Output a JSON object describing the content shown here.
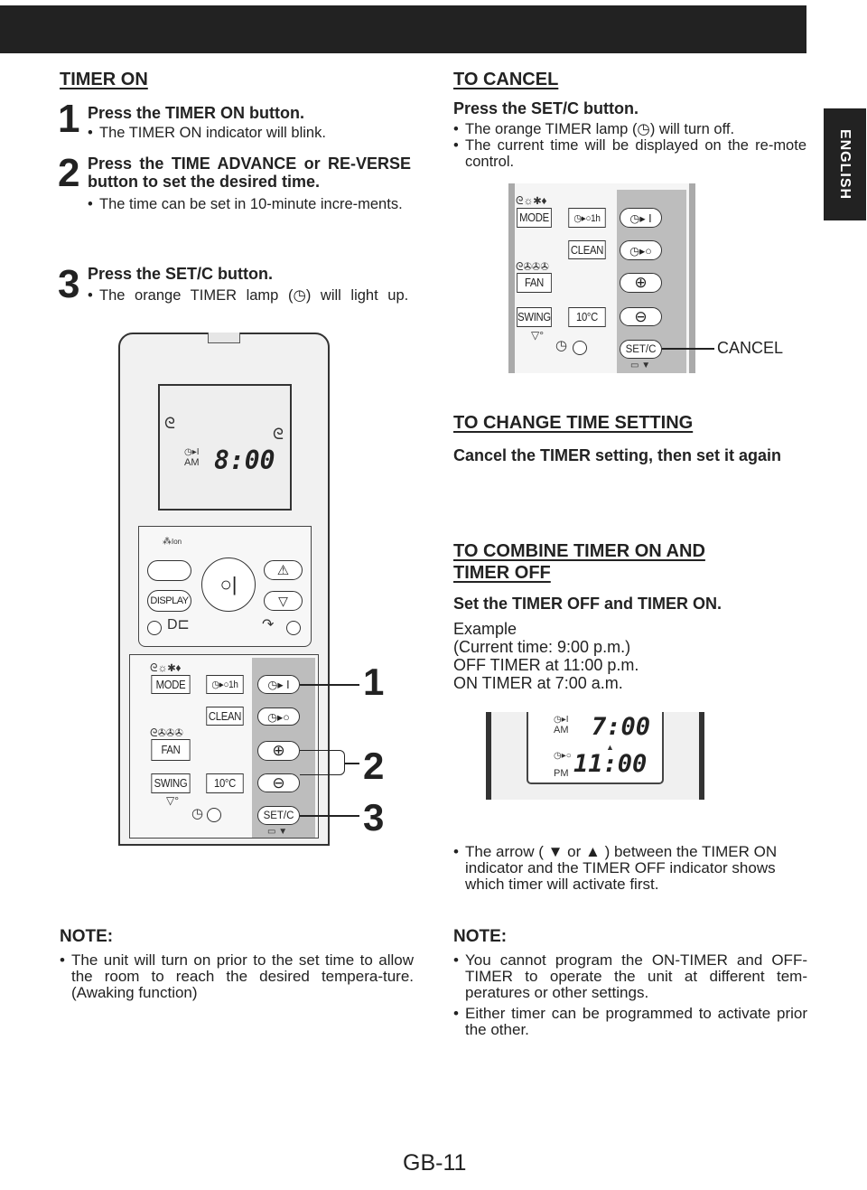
{
  "header": {
    "language_tab": "ENGLISH"
  },
  "timer_on": {
    "heading": "TIMER ON",
    "steps": [
      {
        "number": "1",
        "title": "Press the TIMER ON button.",
        "bullets": [
          "The TIMER ON indicator will blink."
        ]
      },
      {
        "number": "2",
        "title": "Press the TIME ADVANCE or RE-VERSE button to set the desired time.",
        "bullets": [
          "The time can be set in 10-minute incre-ments."
        ]
      },
      {
        "number": "3",
        "title": "Press the SET/C button.",
        "bullets": [
          "The orange TIMER lamp (",
          "◷",
          ") will light up."
        ]
      }
    ]
  },
  "remote": {
    "display": {
      "indicator": "◷▸I",
      "ampm": "AM",
      "time": "8:00"
    },
    "ion_label": "Ion",
    "display_button": "DISPLAY",
    "mode": "MODE",
    "timer_1h": "◷▸○1h",
    "clean": "CLEAN",
    "fan": "FAN",
    "swing": "SWING",
    "temp10": "10°C",
    "setc": "SET/C",
    "timer_on_btn": "◷▸ I",
    "timer_off_btn": "◷▸○",
    "plus": "⊕",
    "minus": "⊖",
    "callouts": [
      "1",
      "2",
      "3"
    ]
  },
  "to_cancel": {
    "heading": "TO CANCEL",
    "subheading": "Press the SET/C button.",
    "bullets": [
      "The orange TIMER lamp (◷) will turn off.",
      "The current time will be displayed on the re-mote control."
    ],
    "callout": "CANCEL"
  },
  "to_change": {
    "heading": "TO CHANGE TIME SETTING",
    "subheading": "Cancel the TIMER setting, then set it again"
  },
  "to_combine": {
    "heading_line1": "TO COMBINE TIMER ON AND",
    "heading_line2": "TIMER OFF",
    "subheading": "Set the TIMER OFF and TIMER ON.",
    "example": [
      "Example",
      "(Current time: 9:00 p.m.)",
      "OFF TIMER at 11:00 p.m.",
      "ON TIMER at 7:00 a.m."
    ],
    "lcd": {
      "on_indicator": "◷▸I",
      "on_ampm": "AM",
      "on_time": "7:00",
      "arrow": "▲",
      "off_indicator": "◷▸○",
      "off_ampm": "PM",
      "off_time": "11:00"
    },
    "bullet": "The arrow ( ▼ or ▲ ) between the TIMER ON indicator and the TIMER OFF indicator shows which timer will activate first."
  },
  "note_left": {
    "heading": "NOTE:",
    "bullets": [
      "The unit will turn on prior to the set time to allow the room to reach the desired tempera-ture. (Awaking function)"
    ]
  },
  "note_right": {
    "heading": "NOTE:",
    "bullets": [
      "You cannot program the ON-TIMER and OFF-TIMER to operate the unit at different tem-peratures or other settings.",
      "Either timer can be programmed to activate prior the other."
    ]
  },
  "footer": {
    "page": "GB-11"
  }
}
